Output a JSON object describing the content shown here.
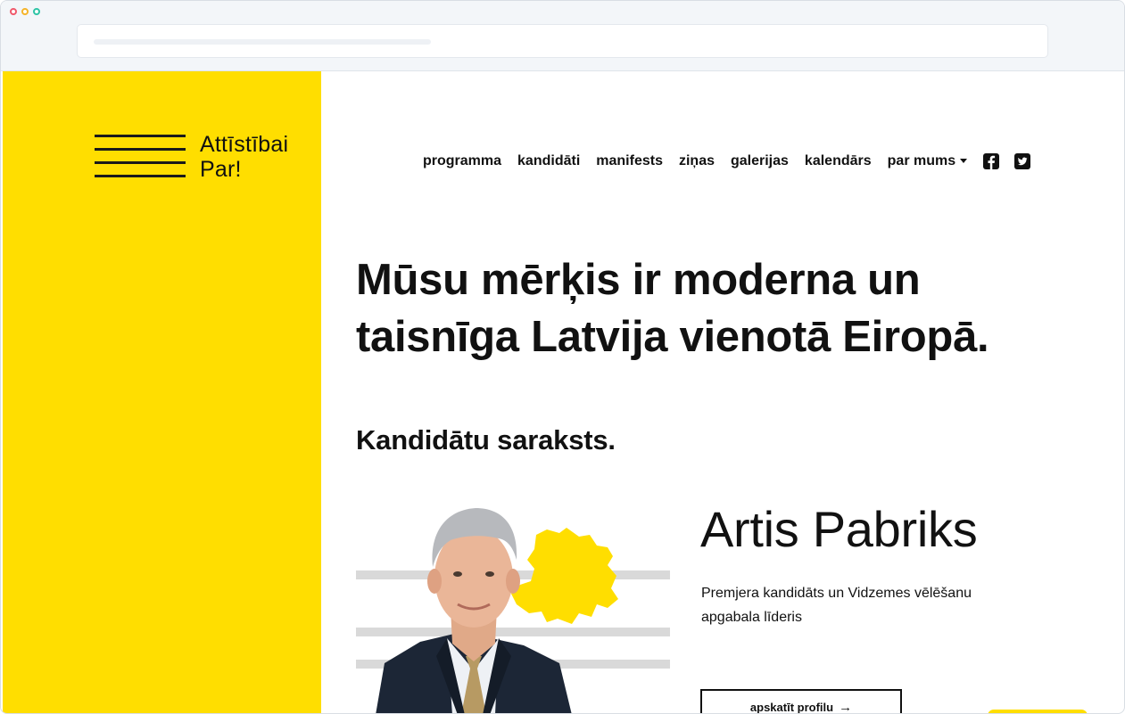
{
  "logo": {
    "line1": "Attīstībai",
    "line2": "Par!"
  },
  "nav": {
    "items": [
      "programma",
      "kandidāti",
      "manifests",
      "ziņas",
      "galerijas",
      "kalendārs",
      "par mums"
    ],
    "social": [
      "facebook-icon",
      "twitter-icon"
    ]
  },
  "hero": {
    "line1": "Mūsu mērķis ir moderna un",
    "line2": "taisnīga Latvija vienotā Eiropā."
  },
  "section": {
    "title": "Kandidātu saraksts."
  },
  "candidate": {
    "name": "Artis Pabriks",
    "description": "Premjera kandidāts un Vidzemes vēlēšanu apgabala līderis",
    "button": "apskatīt profilu"
  },
  "colors": {
    "accent": "#ffde00",
    "text": "#111111",
    "bars": "#d9d9d9"
  }
}
